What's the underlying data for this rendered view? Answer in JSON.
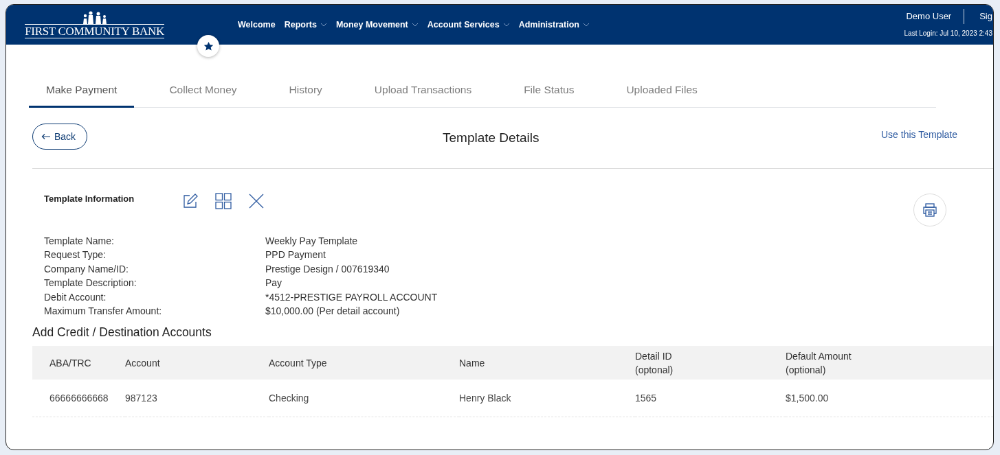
{
  "header": {
    "logo": "FIRST COMMUNITY BANK",
    "nav": [
      {
        "label": "Welcome",
        "dropdown": false
      },
      {
        "label": "Reports",
        "dropdown": true
      },
      {
        "label": "Money Movement",
        "dropdown": true
      },
      {
        "label": "Account Services",
        "dropdown": true
      },
      {
        "label": "Administration",
        "dropdown": true
      }
    ],
    "user": "Demo User",
    "sign": "Sig",
    "last_login": "Last Login: Jul 10, 2023 2:43"
  },
  "tabs": [
    {
      "label": "Make Payment",
      "selected": true
    },
    {
      "label": "Collect Money",
      "selected": false
    },
    {
      "label": "History",
      "selected": false
    },
    {
      "label": "Upload Transactions",
      "selected": false
    },
    {
      "label": "File Status",
      "selected": false
    },
    {
      "label": "Uploaded Files",
      "selected": false
    }
  ],
  "page": {
    "back": "Back",
    "title": "Template Details",
    "action": "Use this Template"
  },
  "section": {
    "title": "Template Information"
  },
  "details": [
    {
      "label": "Template Name:",
      "value": "Weekly Pay Template"
    },
    {
      "label": "Request Type:",
      "value": "PPD Payment"
    },
    {
      "label": "Company Name/ID:",
      "value": "Prestige Design / 007619340"
    },
    {
      "label": "Template Description:",
      "value": "Pay"
    },
    {
      "label": "Debit Account:",
      "value": "*4512-PRESTIGE PAYROLL ACCOUNT"
    },
    {
      "label": "Maximum Transfer Amount:",
      "value": "$10,000.00 (Per detail account)"
    }
  ],
  "table": {
    "title": "Add Credit / Destination Accounts",
    "columns": [
      {
        "label": "ABA/TRC"
      },
      {
        "label": "Account"
      },
      {
        "label": "Account Type"
      },
      {
        "label": "Name"
      },
      {
        "label": "Detail ID",
        "note": "(optonal)"
      },
      {
        "label": "Default Amount",
        "note": "(optional)"
      }
    ],
    "rows": [
      [
        "66666666668",
        "987123",
        "Checking",
        "Henry Black",
        "1565",
        "$1,500.00"
      ]
    ]
  }
}
